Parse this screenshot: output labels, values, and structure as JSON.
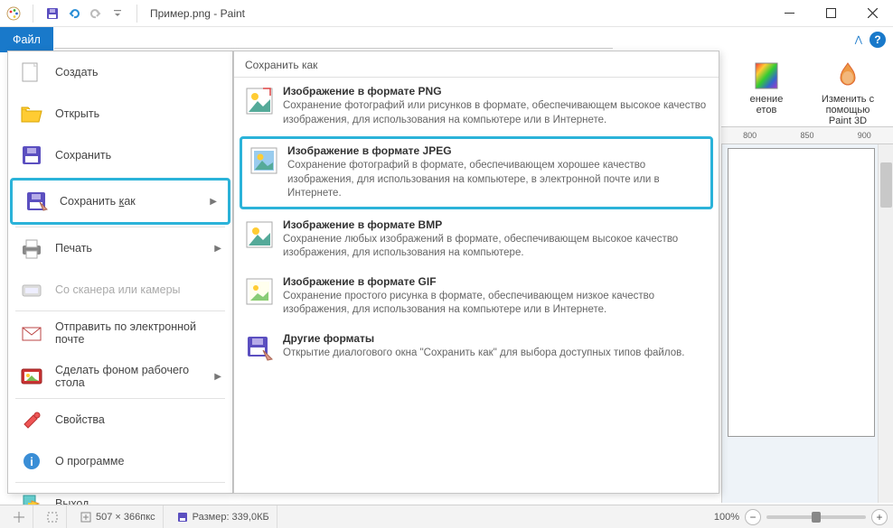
{
  "app": {
    "title_filename": "Пример.png",
    "title_app": "Paint"
  },
  "quick_access": {
    "save": "save",
    "undo": "undo",
    "redo": "redo"
  },
  "tabs": {
    "file": "Файл"
  },
  "ribbon_right": {
    "item1_l1": "енение",
    "item1_l2": "етов",
    "item2_l1": "Изменить с",
    "item2_l2": "помощью Paint 3D"
  },
  "ruler": {
    "t1": "800",
    "t2": "850",
    "t3": "900"
  },
  "file_menu": {
    "create": "Создать",
    "open": "Открыть",
    "save": "Сохранить",
    "save_as": "Сохранить как",
    "print": "Печать",
    "scanner": "Со сканера или камеры",
    "email": "Отправить по электронной почте",
    "wallpaper": "Сделать фоном рабочего стола",
    "properties": "Свойства",
    "about": "О программе",
    "exit": "Выход"
  },
  "submenu": {
    "header": "Сохранить как",
    "png": {
      "title": "Изображение в формате PNG",
      "desc": "Сохранение фотографий или рисунков в формате, обеспечивающем высокое качество изображения, для использования на компьютере или в Интернете."
    },
    "jpeg": {
      "title": "Изображение в формате JPEG",
      "desc": "Сохранение фотографий в формате, обеспечивающем хорошее качество изображения, для использования на компьютере, в электронной почте или в Интернете."
    },
    "bmp": {
      "title": "Изображение в формате BMP",
      "desc": "Сохранение любых изображений в формате, обеспечивающем высокое качество изображения, для использования на компьютере."
    },
    "gif": {
      "title": "Изображение в формате GIF",
      "desc": "Сохранение простого рисунка в формате, обеспечивающем низкое качество изображения, для использования на компьютере или в Интернете."
    },
    "other": {
      "title": "Другие форматы",
      "desc": "Открытие диалогового окна \"Сохранить как\" для выбора доступных типов файлов."
    }
  },
  "statusbar": {
    "dims": "507 × 366пкс",
    "size": "Размер: 339,0КБ",
    "zoom": "100%"
  }
}
